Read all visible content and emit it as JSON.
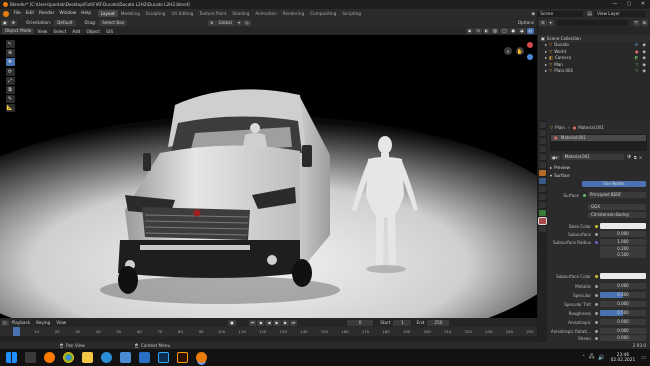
{
  "window": {
    "title": "Blender* [C:\\Users\\ponlak\\Desktop\\Fiat\\FIAT-Ducato\\Ducato L2H2\\Ducato L2H2.blend]",
    "controls": [
      "—",
      "▢",
      "✕"
    ]
  },
  "menubar": {
    "menus": [
      "File",
      "Edit",
      "Render",
      "Window",
      "Help"
    ],
    "workspaces": [
      "Layout",
      "Modeling",
      "Sculpting",
      "UV Editing",
      "Texture Paint",
      "Shading",
      "Animation",
      "Rendering",
      "Compositing",
      "Scripting"
    ],
    "active_workspace": "Layout",
    "scene": "Scene",
    "view_layer": "View Layer"
  },
  "viewport_header": {
    "orientation_label": "Orientation:",
    "orientation": "Default",
    "drag_label": "Drag:",
    "drag": "Select Box",
    "pivot": "Global",
    "options": "Options"
  },
  "viewport_header2": {
    "mode": "Object Mode",
    "menus": [
      "View",
      "Select",
      "Add",
      "Object",
      "GIS"
    ]
  },
  "toolbar": {
    "tools": [
      "cursor",
      "move",
      "rotate",
      "scale",
      "transform",
      "annotate",
      "measure",
      "add"
    ]
  },
  "outliner": {
    "title": "Scene Collection",
    "items": [
      {
        "name": "Scene Collection",
        "indent": 0
      },
      {
        "name": "Ducato",
        "indent": 1
      },
      {
        "name": "World",
        "indent": 1
      },
      {
        "name": "Camera",
        "indent": 1
      },
      {
        "name": "Man",
        "indent": 1
      },
      {
        "name": "Plain.001",
        "indent": 1
      }
    ]
  },
  "properties": {
    "object_name": "Plain",
    "material_slot": "Material.001",
    "material_field": "Material.001",
    "sections": {
      "preview": "Preview",
      "surface": "Surface"
    },
    "use_nodes_label": "Use Nodes",
    "surface_label": "Surface",
    "surface_value": "Principled BSDF",
    "distribution": "GGX",
    "subsurface_method": "Christensen-Burley",
    "rows": [
      {
        "label": "Base Color",
        "value": "",
        "type": "color"
      },
      {
        "label": "Subsurface",
        "value": "0.000"
      },
      {
        "label": "Subsurface Radius",
        "value": "1.000"
      },
      {
        "label": "",
        "value": "0.200"
      },
      {
        "label": "",
        "value": "0.100"
      },
      {
        "label": "Subsurface Color",
        "value": "",
        "type": "color"
      },
      {
        "label": "Metallic",
        "value": "0.000"
      },
      {
        "label": "Specular",
        "value": "0.500",
        "type": "blue"
      },
      {
        "label": "Specular Tint",
        "value": "0.000"
      },
      {
        "label": "Roughness",
        "value": "0.500",
        "type": "blue"
      },
      {
        "label": "Anisotropic",
        "value": "0.000"
      },
      {
        "label": "Anisotropic Rotati...",
        "value": "0.000"
      },
      {
        "label": "Sheen",
        "value": "0.000"
      }
    ]
  },
  "timeline": {
    "menus": [
      "Playback",
      "Keying",
      "View"
    ],
    "frame": "0",
    "start_label": "Start",
    "start": "1",
    "end_label": "End",
    "end": "250",
    "ticks": [
      "0",
      "10",
      "20",
      "30",
      "40",
      "50",
      "60",
      "70",
      "80",
      "90",
      "100",
      "110",
      "120",
      "130",
      "140",
      "150",
      "160",
      "170",
      "180",
      "190",
      "200",
      "210",
      "220",
      "230",
      "240",
      "250"
    ]
  },
  "statusbar": {
    "left": "Pan View",
    "middle": "Context Menu",
    "version": "2.93.0"
  },
  "taskbar": {
    "time": "23:46",
    "date": "02.02.2021"
  },
  "colors": {
    "accent": "#4a72b0",
    "active_tab": "#444444",
    "panel": "#2b2b2b"
  }
}
